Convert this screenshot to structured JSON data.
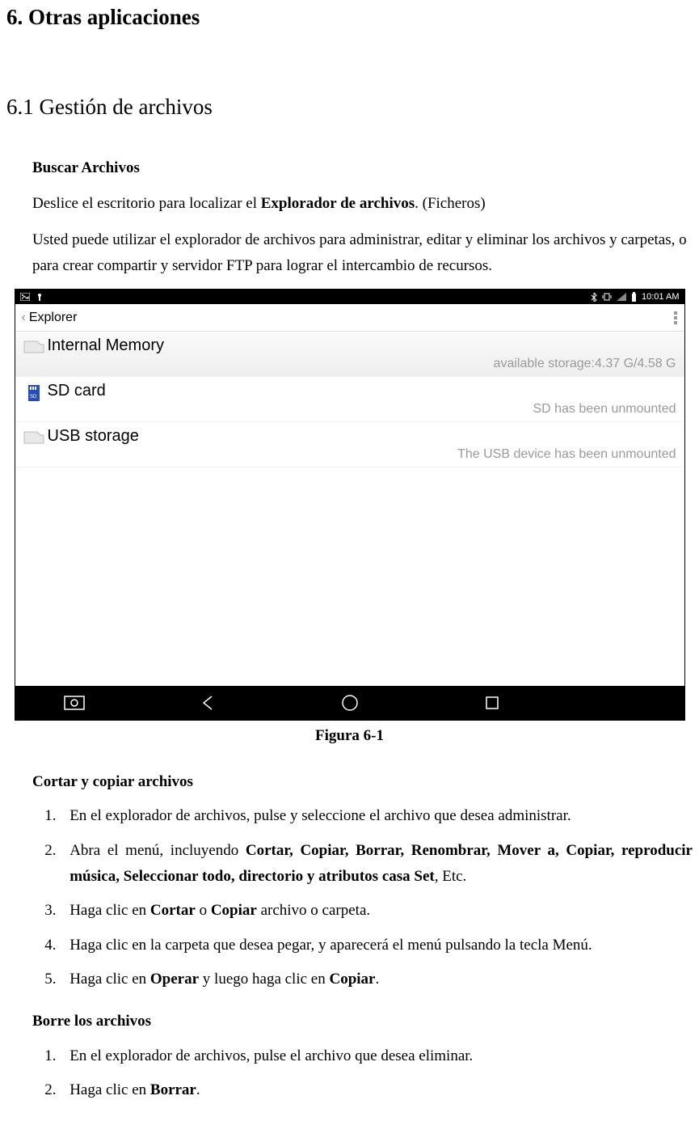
{
  "doc": {
    "h1": "6. Otras aplicaciones",
    "h2": "6.1 Gestión de archivos",
    "sub_buscar": "Buscar Archivos",
    "p1a": "Deslice el escritorio para localizar el ",
    "p1b": "Explorador de archivos",
    "p1c": ". (Ficheros)",
    "p2": "Usted puede utilizar el explorador de archivos para administrar, editar y eliminar los archivos y carpetas, o para crear compartir y servidor FTP para lograr el intercambio de recursos.",
    "fig": "Figura 6-1",
    "sub_cortar": "Cortar y copiar archivos",
    "steps_cortar": {
      "s1": "En el explorador de archivos, pulse y seleccione el archivo que desea administrar.",
      "s2a": "Abra el menú, incluyendo ",
      "s2b": "Cortar, Copiar, Borrar, Renombrar, Mover a, Copiar, reproducir música, Seleccionar todo, directorio y atributos casa Set",
      "s2c": ", Etc.",
      "s3a": "Haga clic en ",
      "s3b": "Cortar",
      "s3c": " o ",
      "s3d": "Copiar",
      "s3e": " archivo o carpeta.",
      "s4": "Haga clic en la carpeta que desea pegar, y aparecerá el menú pulsando la tecla Menú.",
      "s5a": "Haga clic en ",
      "s5b": "Operar",
      "s5c": " y luego haga clic en ",
      "s5d": "Copiar",
      "s5e": "."
    },
    "sub_borre": "Borre los archivos",
    "steps_borre": {
      "s1": "En el explorador de archivos, pulse el archivo que desea eliminar.",
      "s2a": "Haga clic en ",
      "s2b": "Borrar",
      "s2c": "."
    }
  },
  "shot": {
    "status": {
      "time": "10:01 AM"
    },
    "explorer": {
      "title": "Explorer"
    },
    "rows": [
      {
        "title": "Internal Memory",
        "sub": "available storage:4.37 G/4.58 G"
      },
      {
        "title": "SD card",
        "sub": "SD has been unmounted"
      },
      {
        "title": "USB storage",
        "sub": "The USB device has been unmounted"
      }
    ]
  }
}
